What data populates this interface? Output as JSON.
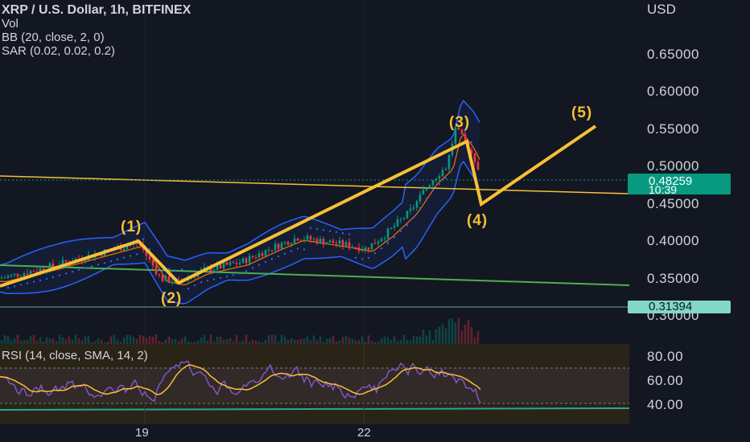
{
  "header": {
    "title": "XRP / U.S. Dollar, 1h, BITFINEX",
    "indicators": [
      "Vol",
      "BB (20, close, 2, 0)",
      "SAR (0.02, 0.02, 0.2)"
    ]
  },
  "price_axis": {
    "currency": "USD",
    "ticks": [
      "0.65000",
      "0.60000",
      "0.55000",
      "0.50000",
      "0.45000",
      "0.40000",
      "0.35000",
      "0.30000"
    ],
    "current_price": "0.48259",
    "countdown": "10:39",
    "line_price": "0.31394"
  },
  "rsi": {
    "label": "RSI (14, close, SMA, 14, 2)",
    "ticks": [
      "80.00",
      "60.00",
      "40.00"
    ]
  },
  "time_axis": {
    "labels": [
      "19",
      "22"
    ]
  },
  "waves": [
    "(1)",
    "(2)",
    "(3)",
    "(4)",
    "(5)"
  ],
  "colors": {
    "background": "#131722",
    "wave": "#f7c035",
    "bollinger": "#2962ff",
    "up": "#089981",
    "down": "#f23645",
    "rsi_line": "#7e57c2",
    "rsi_sma": "#f7c035",
    "trendline_top": "#f7c035",
    "trendline_bottom": "#4caf50"
  }
}
